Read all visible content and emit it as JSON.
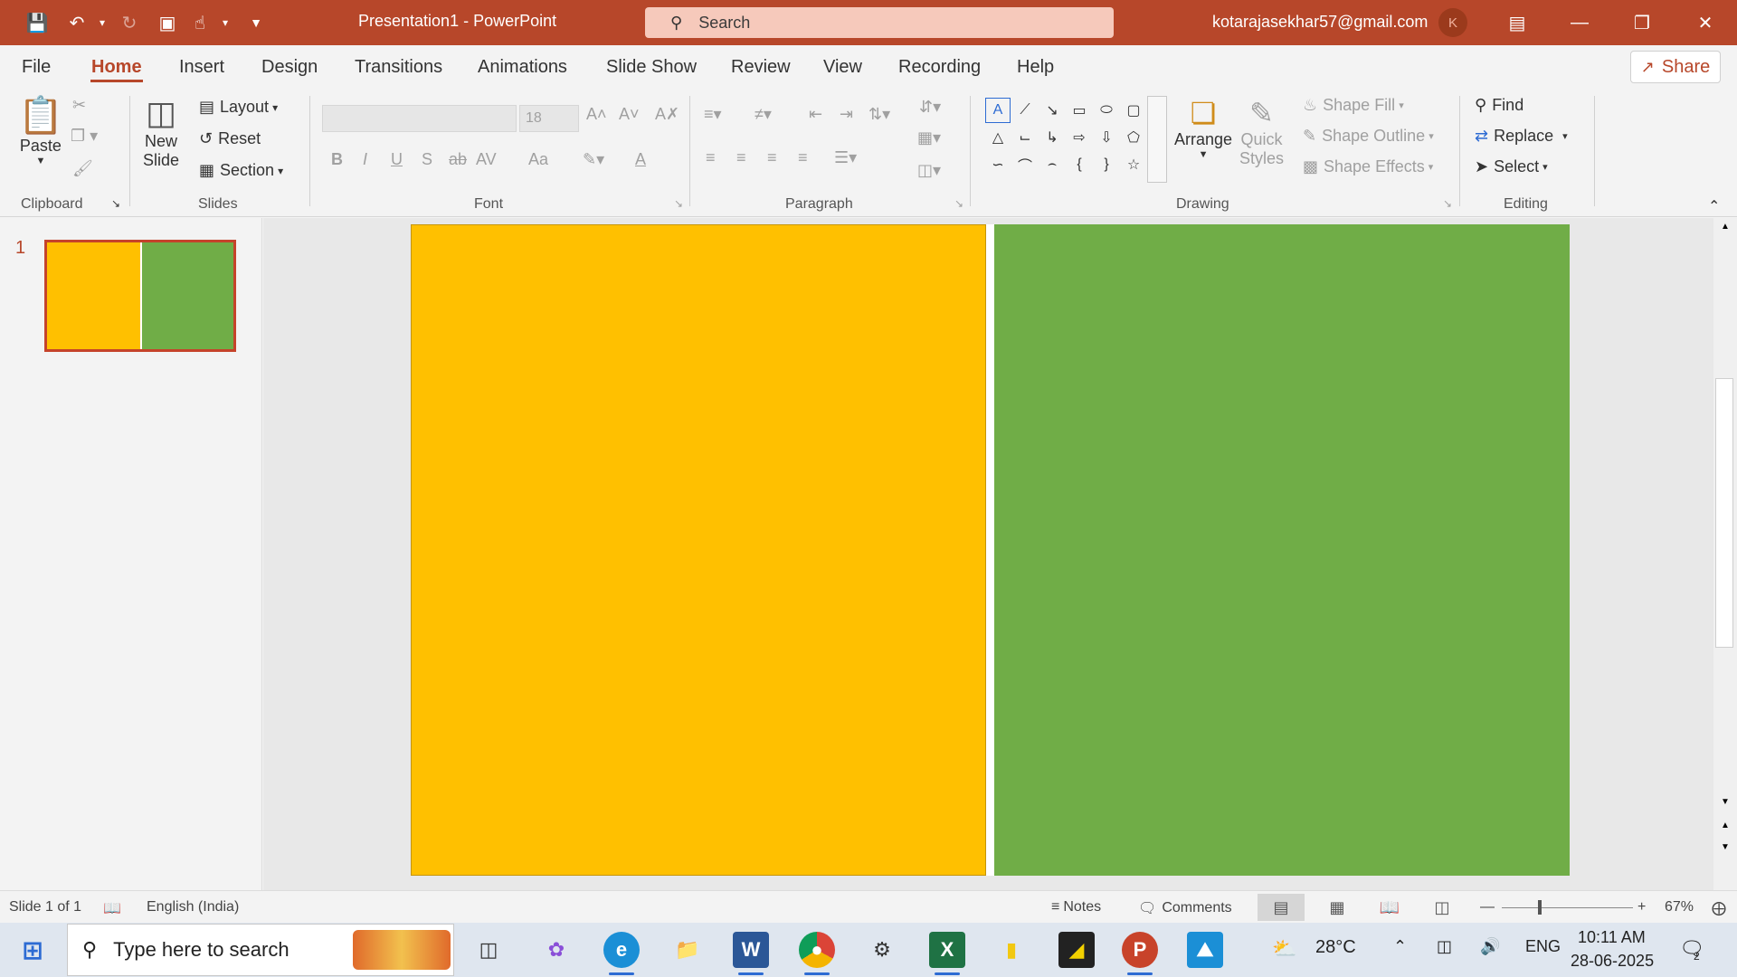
{
  "titlebar": {
    "title": "Presentation1  -  PowerPoint",
    "search_placeholder": "Search",
    "account": "kotarajasekhar57@gmail.com",
    "avatar_initial": "K"
  },
  "menu": {
    "tabs": [
      "File",
      "Home",
      "Insert",
      "Design",
      "Transitions",
      "Animations",
      "Slide Show",
      "Review",
      "View",
      "Recording",
      "Help"
    ],
    "active": "Home",
    "share": "Share"
  },
  "ribbon": {
    "clipboard": {
      "paste": "Paste",
      "label": "Clipboard"
    },
    "slides": {
      "new_slide_line1": "New",
      "new_slide_line2": "Slide",
      "layout": "Layout",
      "reset": "Reset",
      "section": "Section",
      "label": "Slides"
    },
    "font": {
      "size": "18",
      "label": "Font",
      "bold": "B",
      "italic": "I",
      "underline": "U",
      "shadow": "S",
      "strike": "ab",
      "spacing": "AV",
      "case": "Aa",
      "font_color": "A"
    },
    "paragraph": {
      "label": "Paragraph"
    },
    "drawing": {
      "arrange": "Arrange",
      "quick_line1": "Quick",
      "quick_line2": "Styles",
      "shape_fill": "Shape Fill",
      "shape_outline": "Shape Outline",
      "shape_effects": "Shape Effects",
      "label": "Drawing"
    },
    "editing": {
      "find": "Find",
      "replace": "Replace",
      "select": "Select",
      "label": "Editing"
    }
  },
  "slides_pane": {
    "number": "1",
    "colors": {
      "left": "#ffc000",
      "right": "#70ad47"
    }
  },
  "statusbar": {
    "slide_info": "Slide 1 of 1",
    "language": "English (India)",
    "notes": "Notes",
    "comments": "Comments",
    "zoom": "67%"
  },
  "taskbar": {
    "search_placeholder": "Type here to search",
    "weather": "28°C",
    "lang": "ENG",
    "time": "10:11 AM",
    "date": "28-06-2025",
    "notifications": "2",
    "apps": [
      "task-view-icon",
      "copilot-icon",
      "edge-icon",
      "file-explorer-icon",
      "word-icon",
      "chrome-icon",
      "settings-icon",
      "excel-icon",
      "power-bi-icon",
      "sticky-notes-icon",
      "powerpoint-icon",
      "photos-icon"
    ]
  },
  "colors": {
    "accent": "#b7472a",
    "slide_left": "#ffc000",
    "slide_right": "#70ad47"
  }
}
